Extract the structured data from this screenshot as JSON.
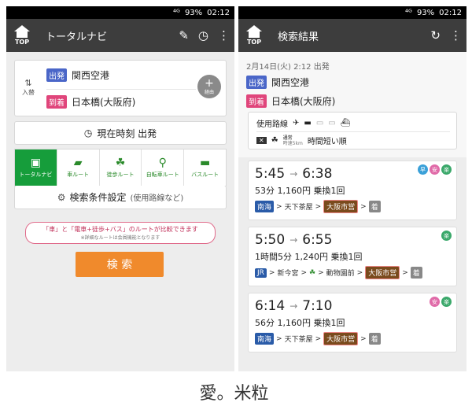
{
  "left": {
    "status": {
      "signal": "⁴ᴳ",
      "battery": "93%",
      "time": "02:12"
    },
    "header": {
      "top_label": "TOP",
      "title": "トータルナビ"
    },
    "swap_label": "入替",
    "departure": {
      "tag": "出発",
      "station": "関西空港"
    },
    "arrival": {
      "tag": "到着",
      "station": "日本橋(大阪府)"
    },
    "via_label": "経由",
    "time_button": "現在時刻 出発",
    "modes": [
      {
        "label": "トータルナビ",
        "icon": "total-navi-icon"
      },
      {
        "label": "車ルート",
        "icon": "car-icon"
      },
      {
        "label": "徒歩ルート",
        "icon": "walk-icon"
      },
      {
        "label": "自転車ルート",
        "icon": "bicycle-icon"
      },
      {
        "label": "バスルート",
        "icon": "bus-icon"
      }
    ],
    "settings": {
      "label": "検索条件設定",
      "sub": "(使用路線など)"
    },
    "notice": {
      "main": "「車」と「電車+徒歩+バス」のルートが比較できます",
      "sub": "※詳細なルートは会員機能となります"
    },
    "search_button": "検 索"
  },
  "right": {
    "status": {
      "signal": "⁴ᴳ",
      "battery": "93%",
      "time": "02:12"
    },
    "header": {
      "top_label": "TOP",
      "title": "検索結果"
    },
    "date": "2月14日(火) 2:12 出発",
    "departure": {
      "tag": "出発",
      "station": "関西空港"
    },
    "arrival": {
      "tag": "到着",
      "station": "日本橋(大阪府)"
    },
    "options": {
      "lines_label": "使用路線",
      "walk_label": "通常",
      "walk_sub": "時速5km",
      "sort": "時間短い順"
    },
    "routes": [
      {
        "dep": "5:45",
        "arr": "6:38",
        "summary": "53分 1,160円 乗換1回",
        "chips": [
          "早",
          "安",
          "楽"
        ],
        "path": [
          {
            "t": "南海",
            "c": "lb-nankai"
          },
          {
            "t": "天下茶屋"
          },
          {
            "t": "大阪市営",
            "c": "lb-osaka"
          },
          {
            "t": "着",
            "c": "lb-arr"
          }
        ]
      },
      {
        "dep": "5:50",
        "arr": "6:55",
        "summary": "1時間5分 1,240円 乗換1回",
        "chips": [
          "楽"
        ],
        "path": [
          {
            "t": "JR",
            "c": "lb-jr"
          },
          {
            "t": "新今宮"
          },
          {
            "t": "動物園前"
          },
          {
            "t": "大阪市営",
            "c": "lb-osaka"
          },
          {
            "t": "着",
            "c": "lb-arr"
          }
        ]
      },
      {
        "dep": "6:14",
        "arr": "7:10",
        "summary": "56分 1,160円 乗換1回",
        "chips": [
          "安",
          "楽"
        ],
        "path": [
          {
            "t": "南海",
            "c": "lb-nankai"
          },
          {
            "t": "天下茶屋"
          },
          {
            "t": "大阪市営",
            "c": "lb-osaka"
          },
          {
            "t": "着",
            "c": "lb-arr"
          }
        ]
      }
    ]
  },
  "watermark": "愛。米粒"
}
